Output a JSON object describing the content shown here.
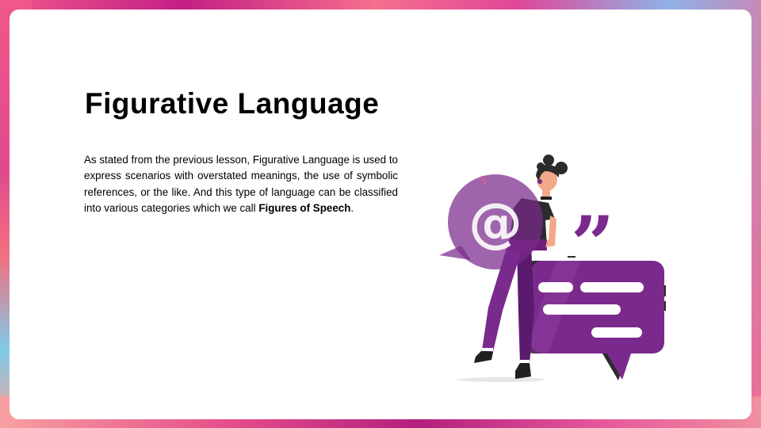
{
  "slide": {
    "title": "Figurative Language",
    "body_text": "As stated from the previous lesson, Figurative Language is used to express scenarios with overstated meanings, the use of symbolic references, or the like. And this type of language can be classified into various categories which we call ",
    "body_bold": "Figures of Speech",
    "body_end": "."
  },
  "illustration": {
    "at_symbol": "@",
    "quote_symbol": "”"
  },
  "colors": {
    "accent_purple": "#7a2a8c",
    "dark_purple": "#5b1a6e",
    "bubble_translucent": "#8b4a99"
  }
}
